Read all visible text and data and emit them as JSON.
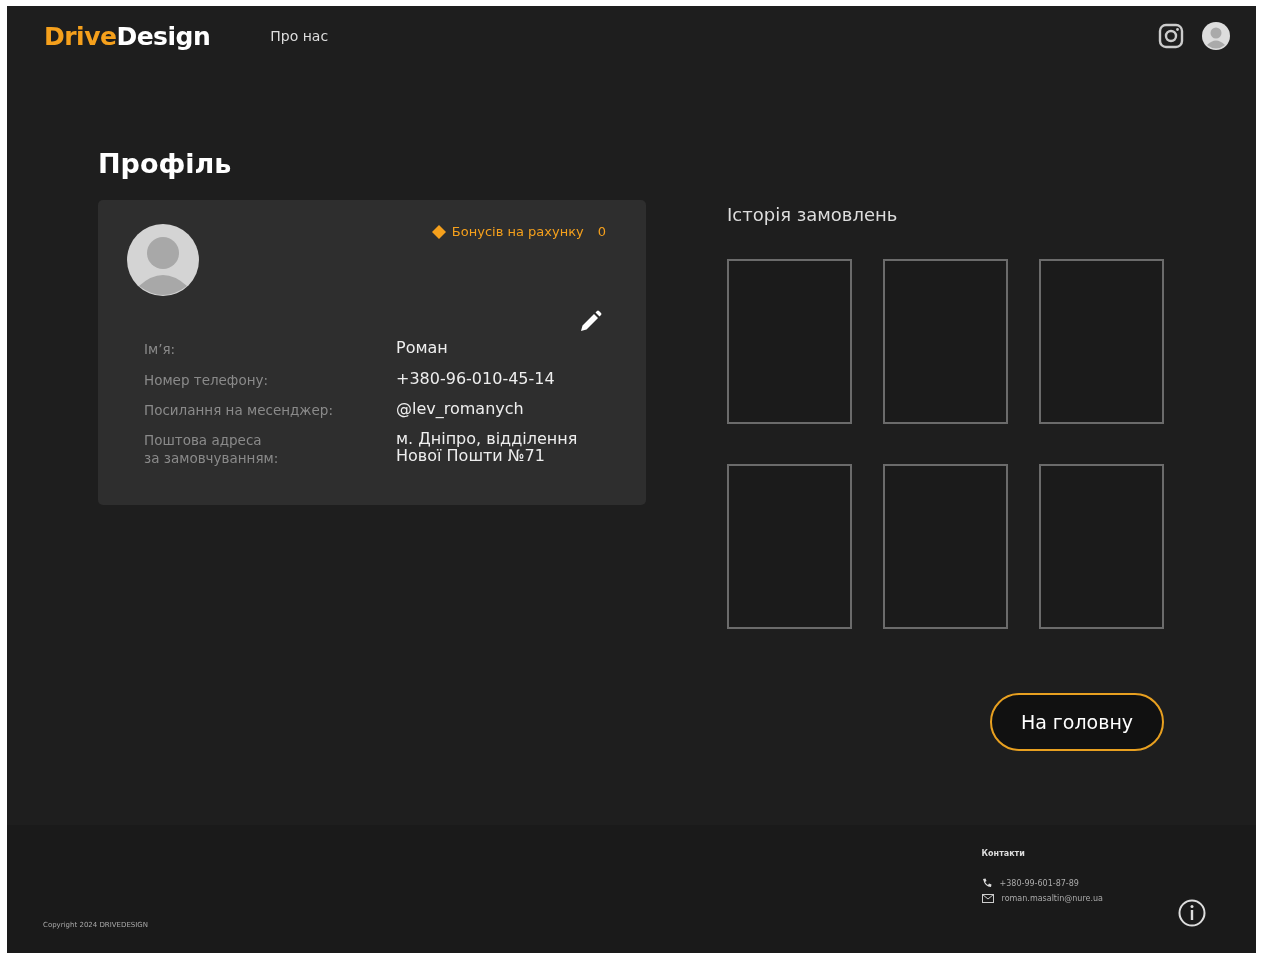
{
  "header": {
    "logo_primary": "Drive",
    "logo_secondary": "Design",
    "nav": [
      {
        "label": "Про нас"
      }
    ]
  },
  "title": "Профіль",
  "profile": {
    "bonus_label": "Бонусів на рахунку",
    "bonus_value": "0",
    "fields": [
      {
        "label": "Ім’я:",
        "value": "Роман"
      },
      {
        "label": "Номер телефону:",
        "value": "+380-96-010-45-14"
      },
      {
        "label": "Посилання на месенджер:",
        "value": "@lev_romanych"
      },
      {
        "label": "Поштова адреса\nза замовчуванням:",
        "value": "м. Дніпро, відділення\nНової Пошти №71"
      }
    ]
  },
  "orders": {
    "title": "Історія замовлень",
    "items": [
      {
        "kind": "empty"
      },
      {
        "kind": "empty"
      },
      {
        "kind": "empty"
      },
      {
        "kind": "empty"
      },
      {
        "kind": "empty"
      },
      {
        "kind": "empty"
      }
    ]
  },
  "home_button": "На головну",
  "footer": {
    "copyright": "Copyright 2024 DRIVEDESIGN",
    "contacts_title": "Контакти",
    "phone": "+380-99-601-87-89",
    "email": "roman.masaltin@nure.ua"
  }
}
